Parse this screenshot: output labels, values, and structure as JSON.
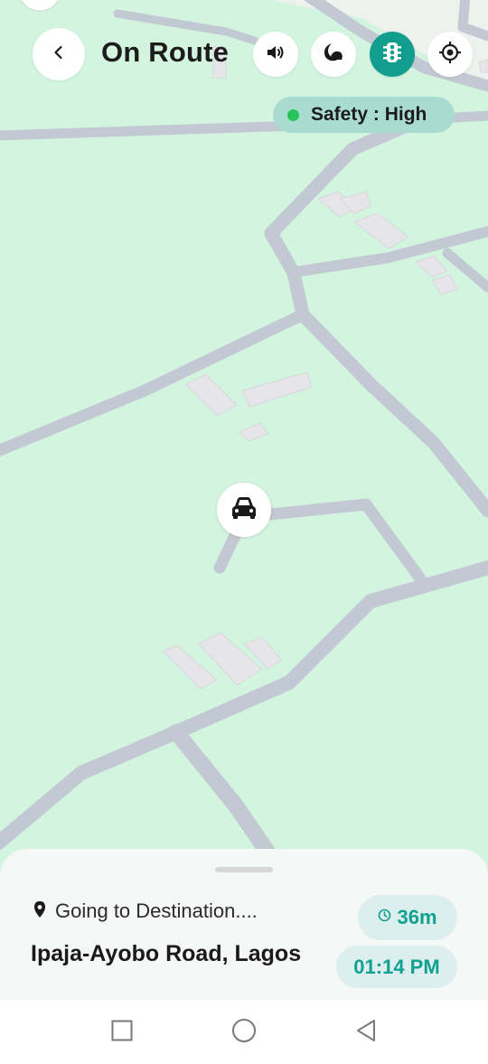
{
  "header": {
    "title": "On Route",
    "back_icon": "chevron-left-icon",
    "actions": [
      {
        "name": "sound-button",
        "icon": "speaker-icon",
        "active": false
      },
      {
        "name": "night-mode-button",
        "icon": "moon-icon",
        "active": false
      },
      {
        "name": "traffic-button",
        "icon": "traffic-light-icon",
        "active": true
      },
      {
        "name": "recenter-button",
        "icon": "crosshair-icon",
        "active": false
      }
    ]
  },
  "safety": {
    "label": "Safety : High",
    "status_color": "#27c45a"
  },
  "map": {
    "background": "#d3f5e0",
    "road_color": "#c3c9d3",
    "building_color": "#e6e6ea",
    "marker_icon": "car-icon"
  },
  "trip": {
    "status_label": "Going to Destination....",
    "destination": "Ipaja-Ayobo Road, Lagos",
    "duration": "36m",
    "arrival_time": "01:14 PM"
  },
  "colors": {
    "accent": "#129e8e",
    "accent_text": "#11a191",
    "chip_bg": "#dcefee"
  },
  "system_nav": {
    "icons": [
      "recent-apps-icon",
      "home-icon",
      "back-icon"
    ]
  }
}
